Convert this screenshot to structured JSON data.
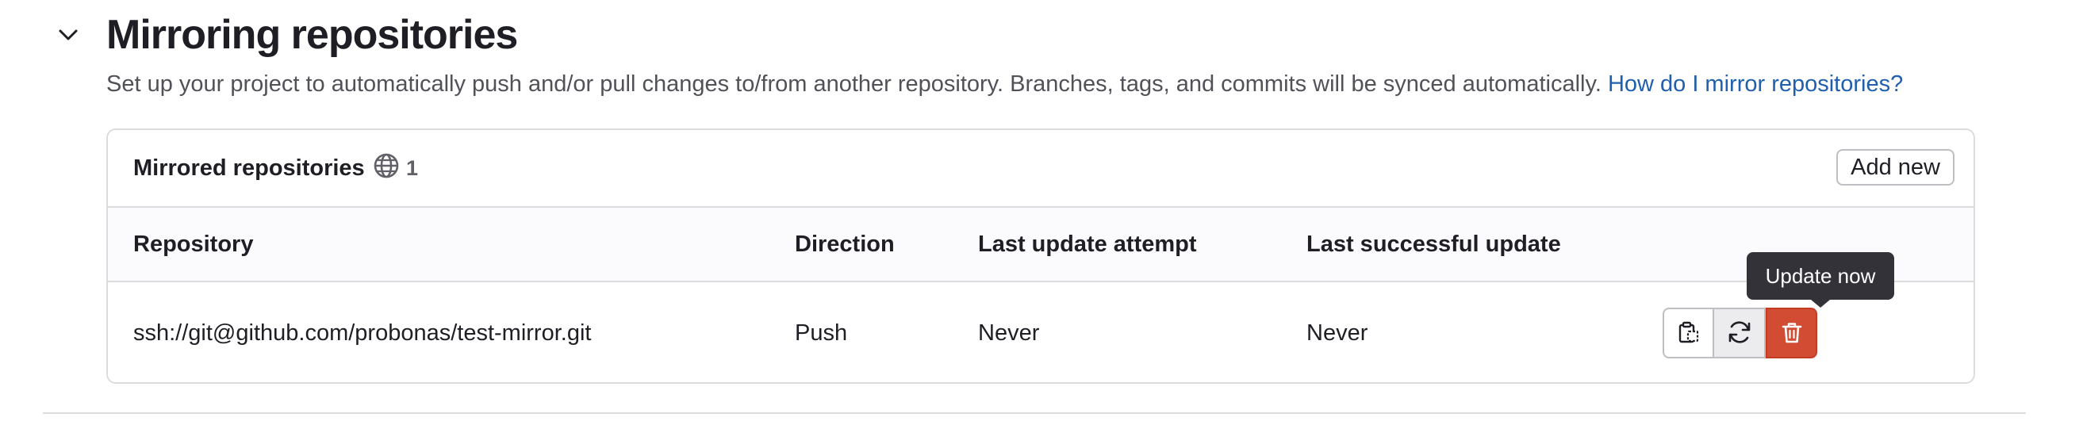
{
  "section": {
    "title": "Mirroring repositories",
    "description": "Set up your project to automatically push and/or pull changes to/from another repository. Branches, tags, and commits will be synced automatically.",
    "help_link": "How do I mirror repositories?"
  },
  "card": {
    "title": "Mirrored repositories",
    "count": "1",
    "count_icon": "globe-icon",
    "add_button": "Add new"
  },
  "table": {
    "headers": {
      "repository": "Repository",
      "direction": "Direction",
      "last_attempt": "Last update attempt",
      "last_success": "Last successful update"
    },
    "rows": [
      {
        "repository": "ssh://git@github.com/probonas/test-mirror.git",
        "direction": "Push",
        "last_attempt": "Never",
        "last_success": "Never"
      }
    ]
  },
  "actions": {
    "copy_icon": "copy-to-clipboard-icon",
    "update_icon": "retry-icon",
    "delete_icon": "trash-icon"
  },
  "tooltip": {
    "text": "Update now"
  },
  "colors": {
    "link": "#1f5fad",
    "danger": "#d24b33",
    "tooltip_bg": "#333238"
  }
}
